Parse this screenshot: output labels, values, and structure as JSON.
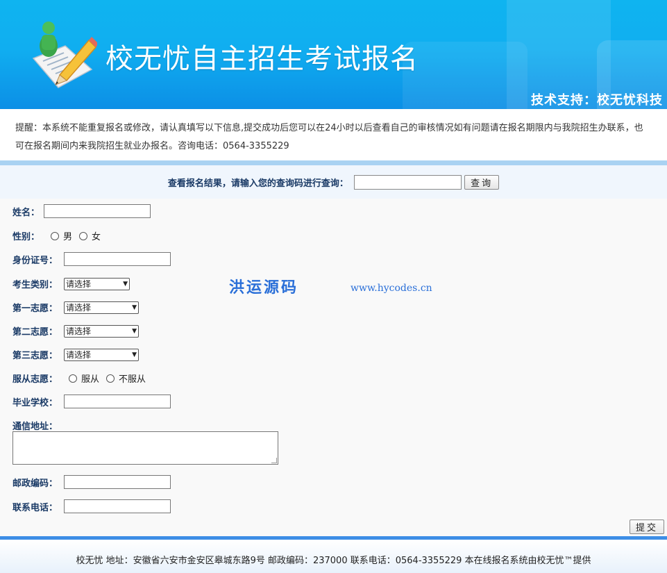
{
  "header": {
    "title": "校无忧自主招生考试报名",
    "support": "技术支持：校无忧科技"
  },
  "notice": {
    "text": "提醒：本系统不能重复报名或修改，请认真填写以下信息,提交成功后您可以在24小时以后查看自己的审核情况如有问题请在报名期限内与我院招生办联系，也可在报名期间内来我院招生就业办报名。咨询电话：0564-3355229"
  },
  "query": {
    "label": "查看报名结果，请输入您的查询码进行查询：",
    "input_value": "",
    "button": "查询"
  },
  "form": {
    "name_label": "姓名：",
    "gender_label": "性别：",
    "gender_options": [
      "男",
      "女"
    ],
    "id_label": "身份证号：",
    "category_label": "考生类别：",
    "category_value": "请选择",
    "choice1_label": "第一志愿：",
    "choice1_value": "请选择",
    "choice2_label": "第二志愿：",
    "choice2_value": "请选择",
    "choice3_label": "第三志愿：",
    "choice3_value": "请选择",
    "obey_label": "服从志愿：",
    "obey_options": [
      "服从",
      "不服从"
    ],
    "school_label": "毕业学校：",
    "address_label": "通信地址：",
    "postcode_label": "邮政编码：",
    "phone_label": "联系电话：",
    "submit": "提交"
  },
  "watermark": {
    "cn": "洪运源码",
    "url": "www.hycodes.cn"
  },
  "footer": {
    "text": "校无忧 地址：安徽省六安市金安区皋城东路9号 邮政编码：237000 联系电话：0564-3355229 本在线报名系统由校无忧™提供"
  },
  "colors": {
    "banner": "#10aef0",
    "label": "#1a3a66",
    "watermark": "#2a6fd8",
    "footer_strip": "#3d8ee6"
  }
}
